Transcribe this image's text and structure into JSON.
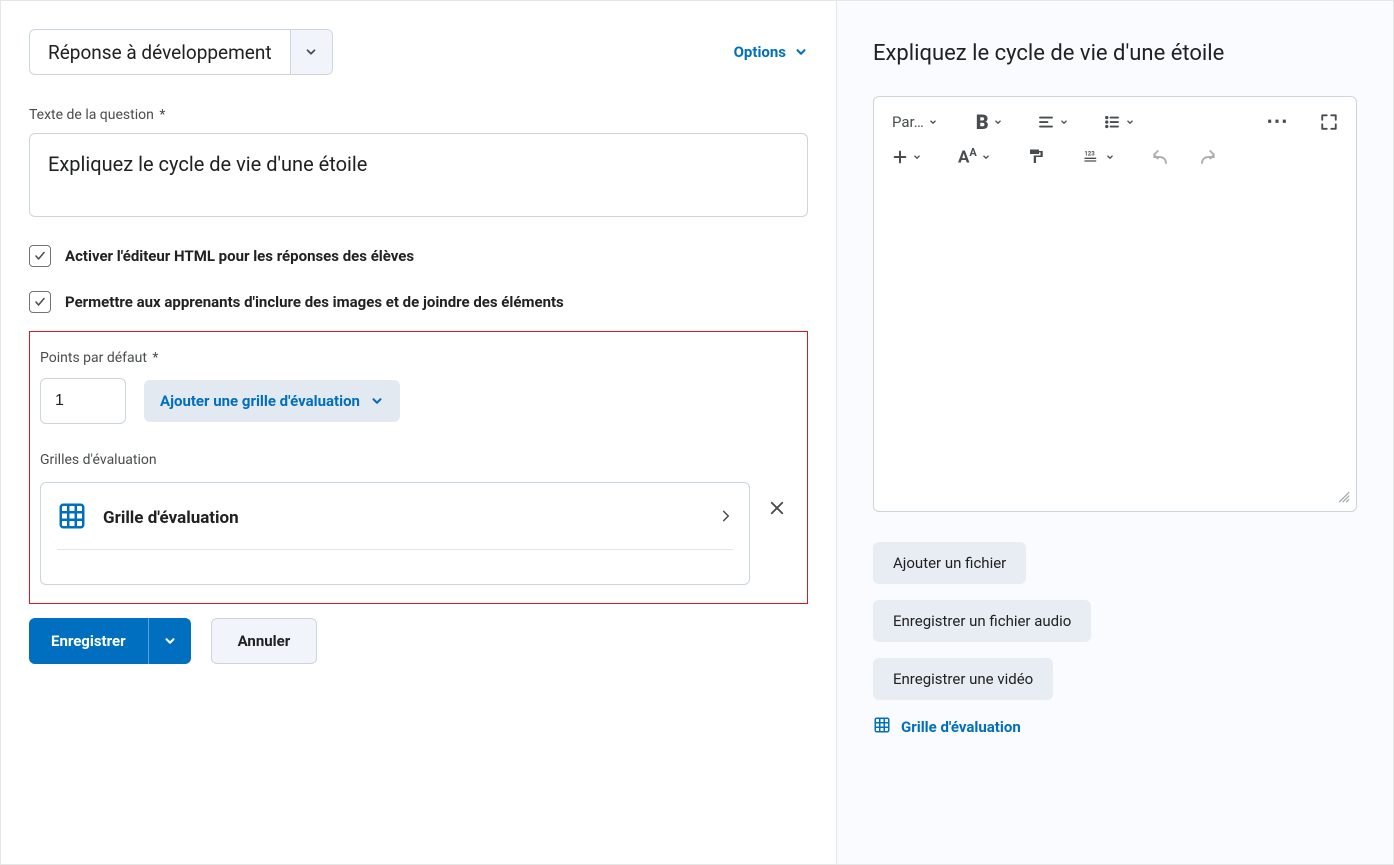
{
  "question_type": "Réponse à développement",
  "options_label": "Options",
  "question_text_label": "Texte de la question",
  "question_text_value": "Expliquez le cycle de vie d'une étoile",
  "checkbox_html_editor": "Activer l'éditeur HTML pour les réponses des élèves",
  "checkbox_allow_attachments": "Permettre aux apprenants d'inclure des images et de joindre des éléments",
  "points_label": "Points par défaut",
  "points_value": "1",
  "add_rubric_label": "Ajouter une grille d'évaluation",
  "rubrics_section_label": "Grilles d'évaluation",
  "rubric_item_title": "Grille d'évaluation",
  "save_label": "Enregistrer",
  "cancel_label": "Annuler",
  "preview": {
    "title": "Expliquez le cycle de vie d'une étoile",
    "toolbar_paragraph_label": "Par…",
    "add_file_label": "Ajouter un fichier",
    "record_audio_label": "Enregistrer un fichier audio",
    "record_video_label": "Enregistrer une vidéo",
    "rubric_link_label": "Grille d'évaluation"
  }
}
